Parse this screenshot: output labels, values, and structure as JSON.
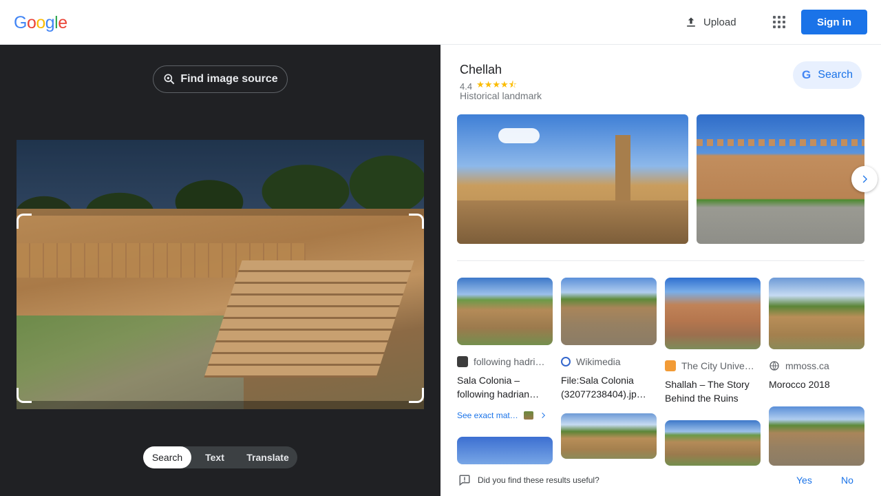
{
  "header": {
    "logo_letters": [
      "G",
      "o",
      "o",
      "g",
      "l",
      "e"
    ],
    "logo_colors": [
      "#4285F4",
      "#EA4335",
      "#FBBC05",
      "#4285F4",
      "#34A853",
      "#EA4335"
    ],
    "upload_label": "Upload",
    "apps_icon": "apps-grid-icon",
    "signin_label": "Sign in"
  },
  "left_panel": {
    "find_source_label": "Find image source",
    "modes": [
      "Search",
      "Text",
      "Translate"
    ],
    "active_mode": "Search"
  },
  "knowledge_panel": {
    "title": "Chellah",
    "rating": "4.4",
    "stars_glyph": "★★★★⯪",
    "type": "Historical landmark",
    "search_label": "Search",
    "search_g": "G"
  },
  "results": [
    {
      "source": "following hadri…",
      "title": "Sala Colonia – following hadrian…",
      "exact_match_label": "See exact mat…"
    },
    {
      "source": "Wikimedia",
      "title": "File:Sala Colonia (32077238404).jp…"
    },
    {
      "source": "The City Unive…",
      "title": "Shallah – The Story Behind the Ruins"
    },
    {
      "source": "mmoss.ca",
      "title": "Morocco 2018"
    }
  ],
  "feedback": {
    "question": "Did you find these results useful?",
    "yes_label": "Yes",
    "no_label": "No"
  },
  "colors": {
    "accent": "#1a73e8",
    "dark_panel": "#202124",
    "star": "#fbbc04"
  }
}
